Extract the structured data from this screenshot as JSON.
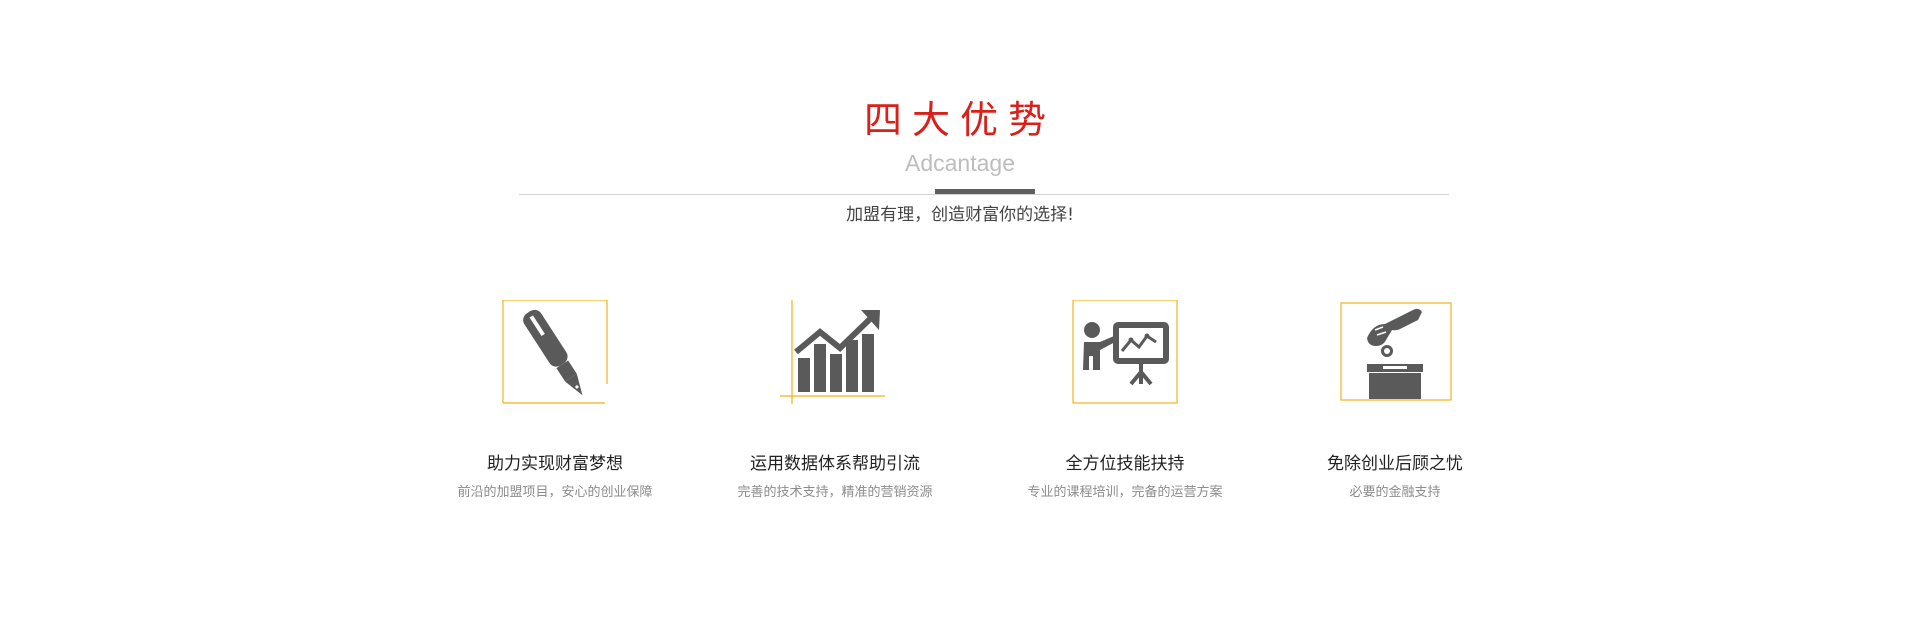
{
  "section": {
    "title": "四大优势",
    "subtitle": "Adcantage",
    "tagline": "加盟有理，创造财富你的选择!"
  },
  "colors": {
    "title": "#d9201b",
    "icon_fill": "#5a5a5a",
    "frame_accent": "#f2b21b",
    "divider_accent": "#5f5f5f"
  },
  "features": [
    {
      "icon": "pen-icon",
      "title": "助力实现财富梦想",
      "desc": "前沿的加盟项目，安心的创业保障"
    },
    {
      "icon": "growth-chart-icon",
      "title": "运用数据体系帮助引流",
      "desc": "完善的技术支持，精准的营销资源"
    },
    {
      "icon": "presentation-icon",
      "title": "全方位技能扶持",
      "desc": "专业的课程培训，完备的运营方案"
    },
    {
      "icon": "donation-box-icon",
      "title": "免除创业后顾之忧",
      "desc": "必要的金融支持"
    }
  ]
}
